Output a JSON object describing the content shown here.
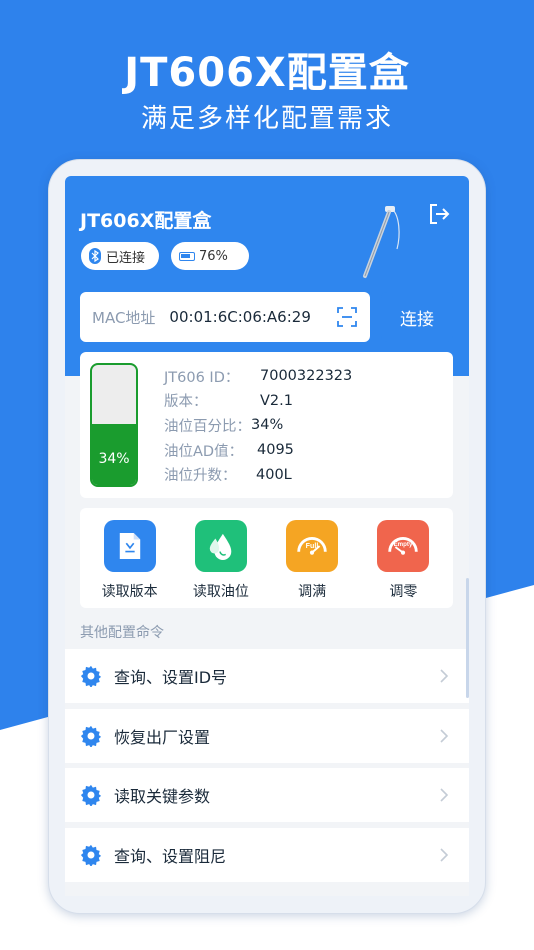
{
  "promo": {
    "title": "JT606X配置盒",
    "subtitle": "满足多样化配置需求"
  },
  "colors": {
    "brand_blue": "#2f86ee",
    "bg_blue": "#2e82ec",
    "tank_green": "#1a9c2e"
  },
  "header": {
    "title": "JT606X配置盒",
    "status_connected": "已连接",
    "battery": "76%",
    "logout_icon": "logout-icon"
  },
  "mac": {
    "label": "MAC地址",
    "value": "00:01:6C:06:A6:29",
    "scan_icon": "scan-icon",
    "connect_label": "连接"
  },
  "info": {
    "tank_percent": 34,
    "tank_text": "34%",
    "rows": [
      {
        "key": "JT606 ID：",
        "value": "7000322323"
      },
      {
        "key": "版本：",
        "value": "V2.1"
      },
      {
        "key": "油位百分比：",
        "value": "34%"
      },
      {
        "key": "油位AD值：",
        "value": "4095"
      },
      {
        "key": "油位升数：",
        "value": "400L"
      }
    ]
  },
  "actions": [
    {
      "label": "读取版本",
      "icon": "document-download-icon",
      "color": "#2f86ee"
    },
    {
      "label": "读取油位",
      "icon": "oil-drop-icon",
      "color": "#1fc07a"
    },
    {
      "label": "调满",
      "icon": "gauge-full-icon",
      "color": "#f5a523",
      "badge": "Full"
    },
    {
      "label": "调零",
      "icon": "gauge-empty-icon",
      "color": "#f0654d",
      "badge": "Empty"
    }
  ],
  "section_label": "其他配置命令",
  "commands": [
    {
      "label": "查询、设置ID号"
    },
    {
      "label": "恢复出厂设置"
    },
    {
      "label": "读取关键参数"
    },
    {
      "label": "查询、设置阻尼"
    }
  ]
}
